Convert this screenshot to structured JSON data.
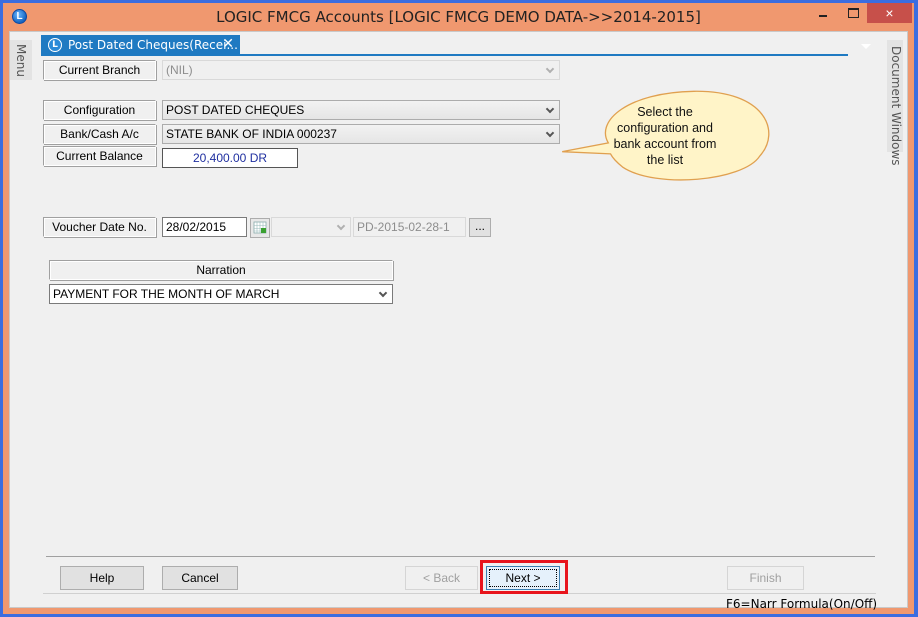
{
  "window": {
    "title": "LOGIC FMCG Accounts  [LOGIC FMCG DEMO DATA->>2014-2015]",
    "app_icon": "logic-app-icon",
    "controls": {
      "minimize": "minimize-icon",
      "maximize": "maximize-icon",
      "close": "×"
    }
  },
  "side_panels": {
    "left_label": "Menu",
    "right_label": "Document Windows"
  },
  "tab": {
    "label": "Post Dated Cheques(Recei...",
    "close": "✕"
  },
  "form": {
    "current_branch": {
      "label": "Current Branch",
      "value": "(NIL)"
    },
    "configuration": {
      "label": "Configuration",
      "value": "POST DATED CHEQUES"
    },
    "bank_cash": {
      "label": "Bank/Cash A/c",
      "value": "STATE BANK OF INDIA 000237"
    },
    "current_balance": {
      "label": "Current Balance",
      "value": "20,400.00 DR"
    },
    "voucher": {
      "label": "Voucher Date  No.",
      "date": "28/02/2015",
      "series": "",
      "number": "PD-2015-02-28-1",
      "browse": "..."
    },
    "narration": {
      "label": "Narration",
      "value": "PAYMENT FOR THE MONTH OF MARCH"
    }
  },
  "callout": {
    "text_lines": [
      "Select the",
      "configuration and",
      "bank account from",
      "the list"
    ]
  },
  "buttons": {
    "help": "Help",
    "cancel": "Cancel",
    "back": "< Back",
    "next": "Next >",
    "finish": "Finish"
  },
  "status_bar": {
    "hint": "F6=Narr Formula(On/Off)"
  },
  "colors": {
    "title_bar": "#f0986f",
    "tab_accent": "#1f7ac2",
    "highlight": "#e8141c",
    "balance_text": "#2030a0",
    "close_button": "#c7504a"
  }
}
